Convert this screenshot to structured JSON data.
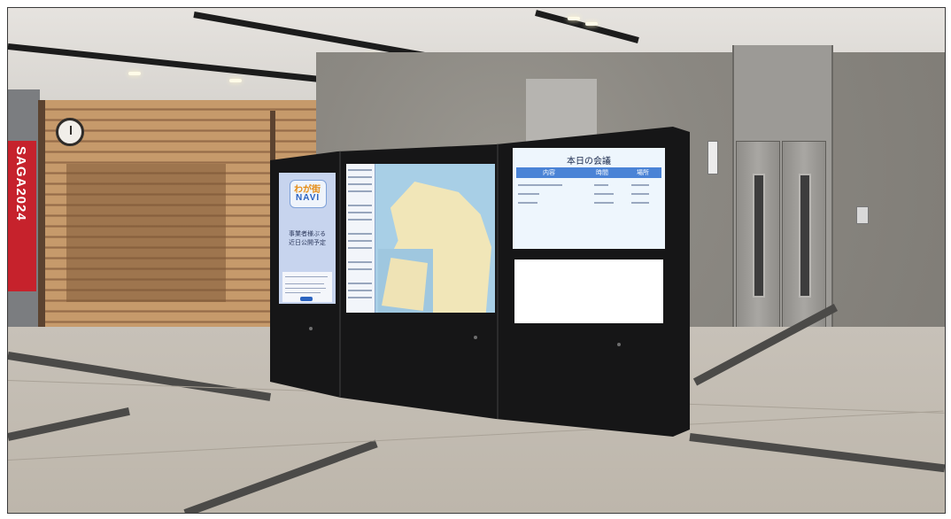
{
  "banner": {
    "text": "SAGA2024"
  },
  "kiosk": {
    "left_screen": {
      "logo_top": "わが街",
      "logo_bottom": "NAVI",
      "notice_line1": "事業者様ぶる",
      "notice_line2": "近日公開予定"
    },
    "right_screen": {
      "title": "本日の会議",
      "columns": [
        "内容",
        "時間",
        "場所"
      ]
    }
  },
  "colors": {
    "kiosk": "#161617",
    "banner": "#c6222c",
    "screen_header": "#4a83d6"
  }
}
